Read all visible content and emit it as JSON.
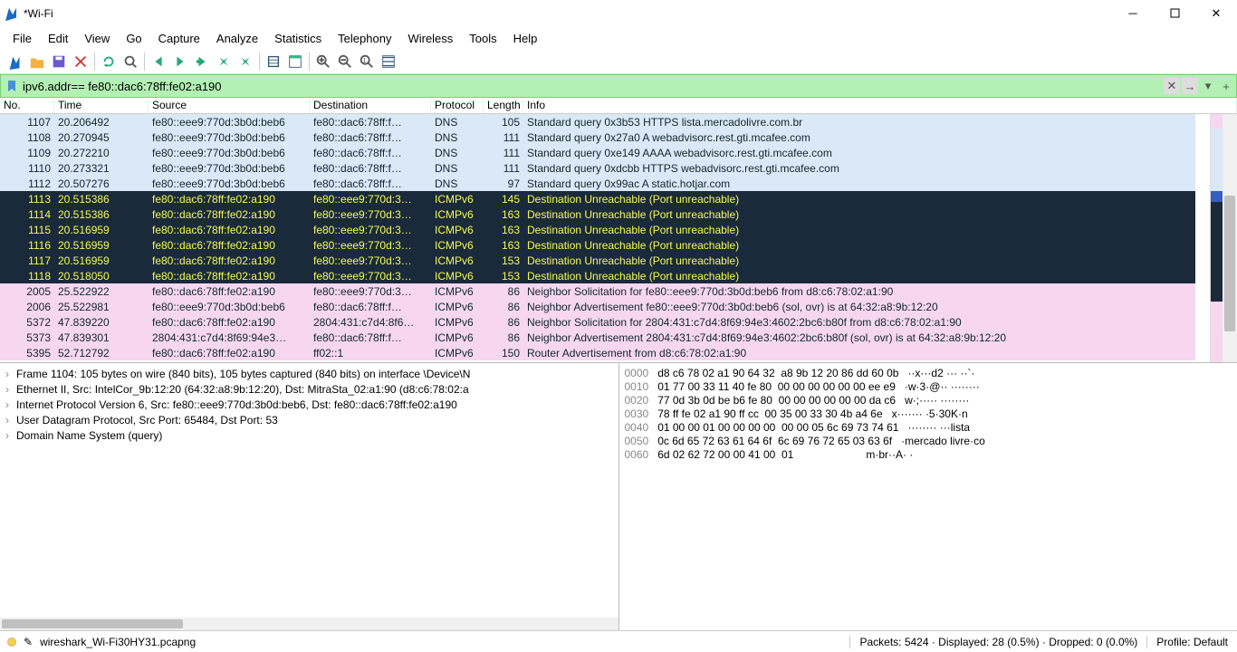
{
  "window": {
    "title": "*Wi-Fi"
  },
  "menu": [
    "File",
    "Edit",
    "View",
    "Go",
    "Capture",
    "Analyze",
    "Statistics",
    "Telephony",
    "Wireless",
    "Tools",
    "Help"
  ],
  "filter": {
    "value": "ipv6.addr== fe80::dac6:78ff:fe02:a190"
  },
  "columns": {
    "no": "No.",
    "time": "Time",
    "src": "Source",
    "dst": "Destination",
    "proto": "Protocol",
    "len": "Length",
    "info": "Info"
  },
  "packets": [
    {
      "no": "1107",
      "time": "20.206492",
      "src": "fe80::eee9:770d:3b0d:beb6",
      "dst": "fe80::dac6:78ff:f…",
      "proto": "DNS",
      "len": "105",
      "info": "Standard query 0x3b53 HTTPS lista.mercadolivre.com.br",
      "style": "dns"
    },
    {
      "no": "1108",
      "time": "20.270945",
      "src": "fe80::eee9:770d:3b0d:beb6",
      "dst": "fe80::dac6:78ff:f…",
      "proto": "DNS",
      "len": "111",
      "info": "Standard query 0x27a0 A webadvisorc.rest.gti.mcafee.com",
      "style": "dns"
    },
    {
      "no": "1109",
      "time": "20.272210",
      "src": "fe80::eee9:770d:3b0d:beb6",
      "dst": "fe80::dac6:78ff:f…",
      "proto": "DNS",
      "len": "111",
      "info": "Standard query 0xe149 AAAA webadvisorc.rest.gti.mcafee.com",
      "style": "dns"
    },
    {
      "no": "1110",
      "time": "20.273321",
      "src": "fe80::eee9:770d:3b0d:beb6",
      "dst": "fe80::dac6:78ff:f…",
      "proto": "DNS",
      "len": "111",
      "info": "Standard query 0xdcbb HTTPS webadvisorc.rest.gti.mcafee.com",
      "style": "dns"
    },
    {
      "no": "1112",
      "time": "20.507276",
      "src": "fe80::eee9:770d:3b0d:beb6",
      "dst": "fe80::dac6:78ff:f…",
      "proto": "DNS",
      "len": "97",
      "info": "Standard query 0x99ac A static.hotjar.com",
      "style": "dns"
    },
    {
      "no": "1113",
      "time": "20.515386",
      "src": "fe80::dac6:78ff:fe02:a190",
      "dst": "fe80::eee9:770d:3…",
      "proto": "ICMPv6",
      "len": "145",
      "info": "Destination Unreachable (Port unreachable)",
      "style": "sel"
    },
    {
      "no": "1114",
      "time": "20.515386",
      "src": "fe80::dac6:78ff:fe02:a190",
      "dst": "fe80::eee9:770d:3…",
      "proto": "ICMPv6",
      "len": "163",
      "info": "Destination Unreachable (Port unreachable)",
      "style": "sel"
    },
    {
      "no": "1115",
      "time": "20.516959",
      "src": "fe80::dac6:78ff:fe02:a190",
      "dst": "fe80::eee9:770d:3…",
      "proto": "ICMPv6",
      "len": "163",
      "info": "Destination Unreachable (Port unreachable)",
      "style": "sel"
    },
    {
      "no": "1116",
      "time": "20.516959",
      "src": "fe80::dac6:78ff:fe02:a190",
      "dst": "fe80::eee9:770d:3…",
      "proto": "ICMPv6",
      "len": "163",
      "info": "Destination Unreachable (Port unreachable)",
      "style": "sel"
    },
    {
      "no": "1117",
      "time": "20.516959",
      "src": "fe80::dac6:78ff:fe02:a190",
      "dst": "fe80::eee9:770d:3…",
      "proto": "ICMPv6",
      "len": "153",
      "info": "Destination Unreachable (Port unreachable)",
      "style": "sel"
    },
    {
      "no": "1118",
      "time": "20.518050",
      "src": "fe80::dac6:78ff:fe02:a190",
      "dst": "fe80::eee9:770d:3…",
      "proto": "ICMPv6",
      "len": "153",
      "info": "Destination Unreachable (Port unreachable)",
      "style": "sel"
    },
    {
      "no": "2005",
      "time": "25.522922",
      "src": "fe80::dac6:78ff:fe02:a190",
      "dst": "fe80::eee9:770d:3…",
      "proto": "ICMPv6",
      "len": "86",
      "info": "Neighbor Solicitation for fe80::eee9:770d:3b0d:beb6 from d8:c6:78:02:a1:90",
      "style": "ra"
    },
    {
      "no": "2006",
      "time": "25.522981",
      "src": "fe80::eee9:770d:3b0d:beb6",
      "dst": "fe80::dac6:78ff:f…",
      "proto": "ICMPv6",
      "len": "86",
      "info": "Neighbor Advertisement fe80::eee9:770d:3b0d:beb6 (sol, ovr) is at 64:32:a8:9b:12:20",
      "style": "ra"
    },
    {
      "no": "5372",
      "time": "47.839220",
      "src": "fe80::dac6:78ff:fe02:a190",
      "dst": "2804:431:c7d4:8f6…",
      "proto": "ICMPv6",
      "len": "86",
      "info": "Neighbor Solicitation for 2804:431:c7d4:8f69:94e3:4602:2bc6:b80f from d8:c6:78:02:a1:90",
      "style": "ra"
    },
    {
      "no": "5373",
      "time": "47.839301",
      "src": "2804:431:c7d4:8f69:94e3…",
      "dst": "fe80::dac6:78ff:f…",
      "proto": "ICMPv6",
      "len": "86",
      "info": "Neighbor Advertisement 2804:431:c7d4:8f69:94e3:4602:2bc6:b80f (sol, ovr) is at 64:32:a8:9b:12:20",
      "style": "ra"
    },
    {
      "no": "5395",
      "time": "52.712792",
      "src": "fe80::dac6:78ff:fe02:a190",
      "dst": "ff02::1",
      "proto": "ICMPv6",
      "len": "150",
      "info": "Router Advertisement from d8:c6:78:02:a1:90",
      "style": "ra"
    }
  ],
  "tree": [
    "Frame 1104: 105 bytes on wire (840 bits), 105 bytes captured (840 bits) on interface \\Device\\N",
    "Ethernet II, Src: IntelCor_9b:12:20 (64:32:a8:9b:12:20), Dst: MitraSta_02:a1:90 (d8:c6:78:02:a",
    "Internet Protocol Version 6, Src: fe80::eee9:770d:3b0d:beb6, Dst: fe80::dac6:78ff:fe02:a190",
    "User Datagram Protocol, Src Port: 65484, Dst Port: 53",
    "Domain Name System (query)"
  ],
  "hex": [
    {
      "off": "0000",
      "h": "d8 c6 78 02 a1 90 64 32  a8 9b 12 20 86 dd 60 0b",
      "a": "··x···d2 ··· ··`·"
    },
    {
      "off": "0010",
      "h": "01 77 00 33 11 40 fe 80  00 00 00 00 00 00 ee e9",
      "a": "·w·3·@·· ········"
    },
    {
      "off": "0020",
      "h": "77 0d 3b 0d be b6 fe 80  00 00 00 00 00 00 da c6",
      "a": "w·;····· ········"
    },
    {
      "off": "0030",
      "h": "78 ff fe 02 a1 90 ff cc  00 35 00 33 30 4b a4 6e",
      "a": "x······· ·5·30K·n"
    },
    {
      "off": "0040",
      "h": "01 00 00 01 00 00 00 00  00 00 05 6c 69 73 74 61",
      "a": "········ ···lista"
    },
    {
      "off": "0050",
      "h": "0c 6d 65 72 63 61 64 6f  6c 69 76 72 65 03 63 6f",
      "a": "·mercado livre·co"
    },
    {
      "off": "0060",
      "h": "6d 02 62 72 00 00 41 00  01",
      "a": "m·br··A· ·"
    }
  ],
  "status": {
    "file": "wireshark_Wi-Fi30HY31.pcapng",
    "mid": "Packets: 5424 · Displayed: 28 (0.5%) · Dropped: 0 (0.0%)",
    "profile": "Profile: Default"
  },
  "toolbar_icons": [
    "fin",
    "folder-open",
    "save",
    "close",
    "reload",
    "search",
    "back",
    "forward",
    "goto",
    "first",
    "last",
    "autoscroll",
    "colorize",
    "zoom-in",
    "zoom-out",
    "zoom-reset",
    "resize-cols"
  ]
}
